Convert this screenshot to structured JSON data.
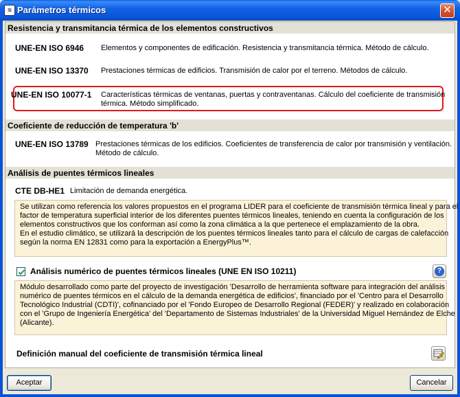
{
  "window": {
    "title": "Parámetros térmicos",
    "app_icon": "app-logo-icon",
    "close_glyph": "✕"
  },
  "sections": {
    "resistance": {
      "header": "Resistencia y transmitancia térmica de los elementos constructivos",
      "standards": [
        {
          "code": "UNE-EN ISO 6946",
          "desc": "Elementos y componentes de edificación. Resistencia y transmitancia térmica. Método de cálculo."
        },
        {
          "code": "UNE-EN ISO 13370",
          "desc": "Prestaciones térmicas de edificios. Transmisión de calor por el terreno. Métodos de cálculo."
        },
        {
          "code": "UNE-EN ISO 10077-1",
          "desc_line1": "Características térmicas de ventanas, puertas y contraventanas. Cálculo del coeficiente de transmisión",
          "desc_line2": "térmica. Método simplificado.",
          "highlight_color": "#e01818"
        }
      ]
    },
    "reduction": {
      "header": "Coeficiente de reducción de temperatura 'b'",
      "standard": {
        "code": "UNE-EN ISO 13789",
        "desc_line1": "Prestaciones térmicas de los edificios. Coeficientes de transferencia de calor por transmisión y ventilación.",
        "desc_line2": "Método de cálculo."
      }
    },
    "bridges": {
      "header": "Análisis de puentes térmicos lineales",
      "cte": {
        "code": "CTE DB-HE1",
        "desc": "Limitación de demanda energética."
      },
      "info_lines": [
        "Se utilizan como referencia los valores propuestos en el programa LIDER para el coeficiente de transmisión térmica lineal y para el",
        "factor de temperatura superficial interior de los diferentes puentes térmicos lineales, teniendo en cuenta la configuración de los",
        "elementos constructivos que los conforman así como la zona climática a la que pertenece el emplazamiento de la obra.",
        "En el estudio climático, se utilizará la descripción de los puentes térmicos lineales tanto para el cálculo de cargas de calefacción",
        "según la norma EN 12831 como para la exportación a EnergyPlus™."
      ],
      "numeric_analysis": {
        "checked": true,
        "label": "Análisis numérico de puentes térmicos lineales (UNE EN ISO 10211)",
        "help_glyph": "?"
      },
      "module_lines": [
        "Módulo desarrollado como parte del proyecto de investigación 'Desarrollo de herramienta software para integración del análisis",
        "numérico de puentes térmicos en el cálculo de la demanda energética de edificios', financiado por el 'Centro para el Desarrollo",
        "Tecnológico Industrial (CDTI)', cofinanciado por el 'Fondo Europeo de Desarrollo Regional (FEDER)' y realizado en colaboración",
        "con el 'Grupo de Ingeniería Energética' del 'Departamento de Sistemas Industriales' de la Universidad Miguel Hernández de Elche",
        "(Alicante)."
      ],
      "manual_definition": {
        "label": "Definición manual del coeficiente de transmisión térmica lineal",
        "icon": "edit-table-icon"
      }
    }
  },
  "buttons": {
    "ok": "Aceptar",
    "cancel": "Cancelar"
  }
}
